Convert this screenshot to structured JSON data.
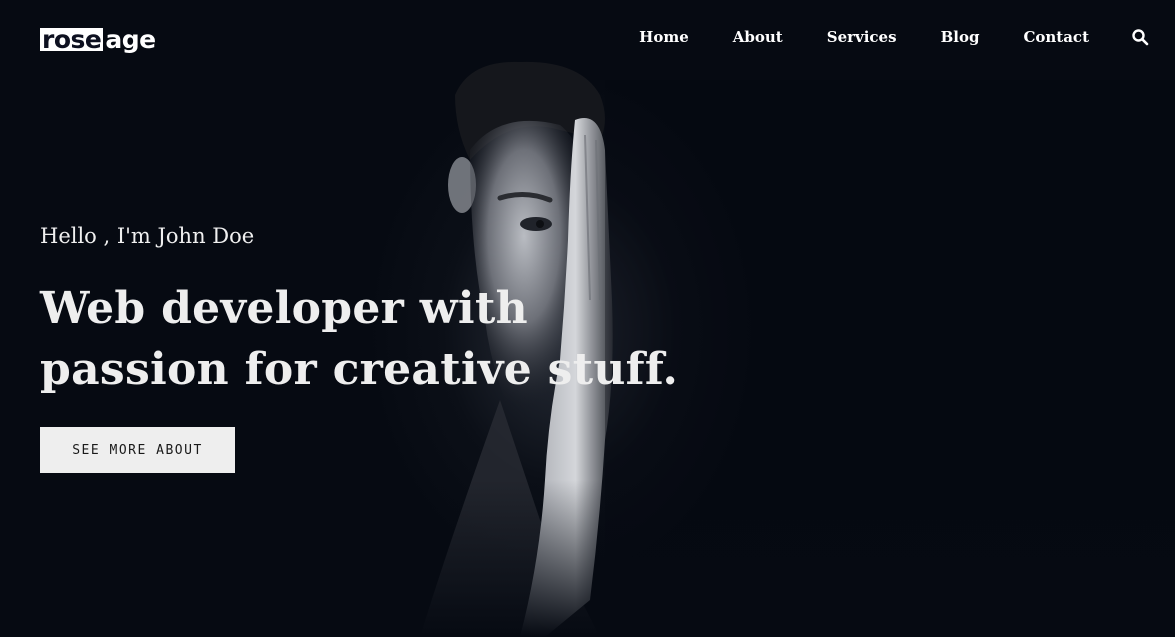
{
  "brand": {
    "logo_boxed": "rose",
    "logo_rest": "age"
  },
  "nav": {
    "items": [
      {
        "label": "Home"
      },
      {
        "label": "About"
      },
      {
        "label": "Services"
      },
      {
        "label": "Blog"
      },
      {
        "label": "Contact"
      }
    ],
    "search_icon": "search-icon"
  },
  "hero": {
    "greeting": "Hello , I'm John Doe",
    "headline_line1": "Web developer with",
    "headline_line2": "passion for creative stuff.",
    "cta_label": "SEE MORE ABOUT"
  },
  "colors": {
    "background": "#060a12",
    "text": "#eeeeee",
    "button_bg": "#eeeeee",
    "button_text": "#1a1a1a"
  }
}
